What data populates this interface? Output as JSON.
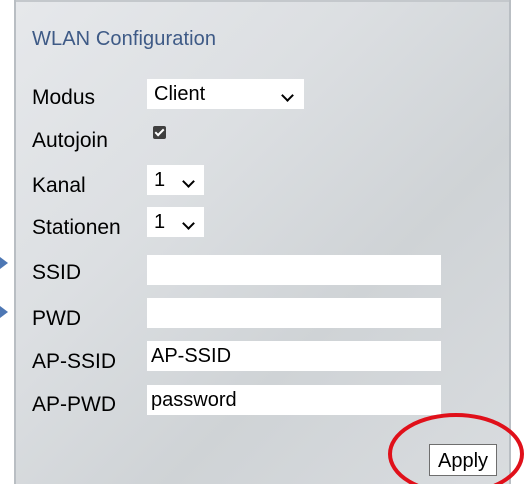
{
  "panel": {
    "title": "WLAN Configuration"
  },
  "fields": {
    "modus": {
      "label": "Modus",
      "value": "Client"
    },
    "autojoin": {
      "label": "Autojoin",
      "checked": true
    },
    "kanal": {
      "label": "Kanal",
      "value": "1"
    },
    "stationen": {
      "label": "Stationen",
      "value": "1"
    },
    "ssid": {
      "label": "SSID",
      "value": ""
    },
    "pwd": {
      "label": "PWD",
      "value": ""
    },
    "ap_ssid": {
      "label": "AP-SSID",
      "value": "AP-SSID"
    },
    "ap_pwd": {
      "label": "AP-PWD",
      "value": "password"
    }
  },
  "actions": {
    "apply_label": "Apply"
  },
  "colors": {
    "title": "#3e5a86",
    "highlight": "#e0101a",
    "arrow": "#4d77b4"
  },
  "icons": {
    "arrows": "arrow-right-icon",
    "checkbox": "checkmark-icon",
    "dropdown": "chevron-down-icon"
  }
}
